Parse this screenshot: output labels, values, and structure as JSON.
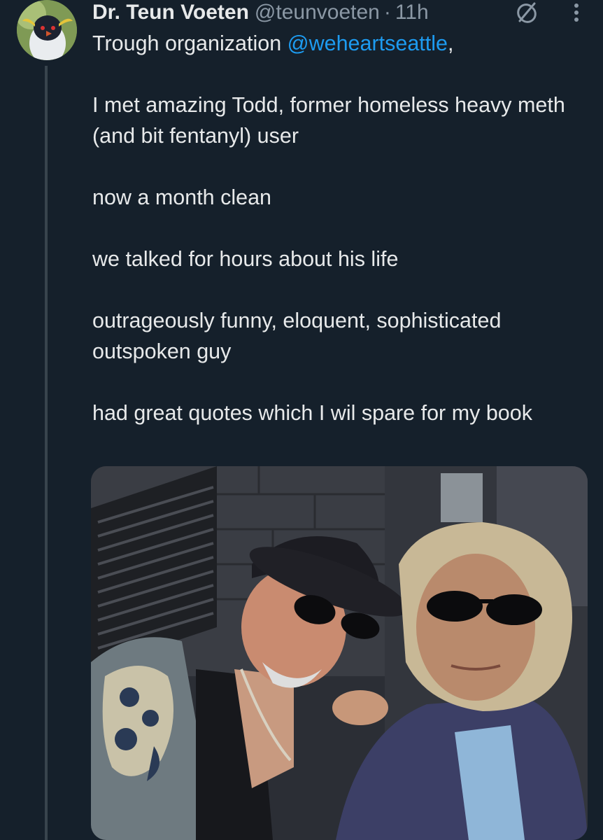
{
  "tweet": {
    "author_name": "Dr. Teun Voeten",
    "handle": "@teunvoeten",
    "separator": "·",
    "time": "11h",
    "line1_prefix": "Trough organization ",
    "mention": "@weheartseattle",
    "line1_suffix": ",",
    "paragraphs": [
      "I met amazing Todd, former homeless heavy meth (and bit fentanyl) user",
      "now a month clean",
      "we talked for hours about his life",
      "outrageously funny, eloquent, sophisticated outspoken guy",
      "had great quotes which I wil spare for my book"
    ]
  },
  "icons": {
    "avatar": "penguin-avatar",
    "grok": "grok-icon",
    "more": "more-vertical-icon"
  },
  "colors": {
    "background": "#15202b",
    "text": "#e7e9ea",
    "secondary": "#8b98a5",
    "link": "#1d9bf0"
  }
}
